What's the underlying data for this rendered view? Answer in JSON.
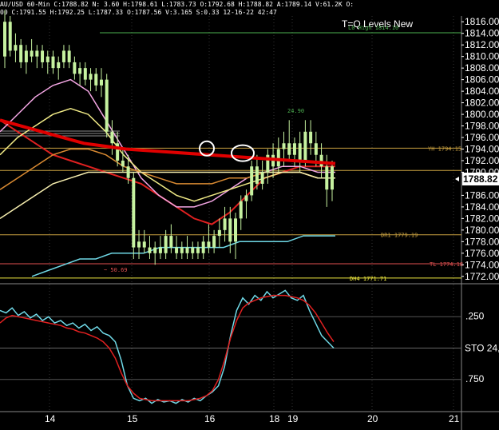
{
  "header": "AU/USD 60-Min C:1788.82 N: 3.60 H:1798.61 L:1783.73 O:1792.68 H:1788.82 A:1789.14 V:61.2K O:",
  "subheader": "00 C:1791.55 H:1792.25 L:1787.33 O:1787.56 V:3.165 S:0.33 12-16-22 42:47",
  "title": "T=Q Levels New",
  "colors": {
    "background": "#000000",
    "candle": "#c6f2a0",
    "ma_red": "#e02020",
    "ma_pink": "#f4a6e4",
    "ma_yellow": "#f0ea86",
    "ma_orange": "#d98a32",
    "ma_cyan": "#6fd8e6",
    "trendline": "#e00000",
    "sto_fast": "#6fd8e6",
    "sto_slow": "#e02020"
  },
  "chart_data": [
    {
      "type": "line",
      "panel": "price",
      "y_ticks": [
        "1816.00",
        "1814.00",
        "1812.00",
        "1810.00",
        "1808.00",
        "1806.00",
        "1804.00",
        "1802.00",
        "1800.00",
        "1798.00",
        "1796.00",
        "1794.00",
        "1792.00",
        "1790.00",
        "1788.82",
        "1786.00",
        "1784.00",
        "1782.00",
        "1780.00",
        "1778.00",
        "1776.00",
        "1774.00",
        "1772.00"
      ],
      "ylim": [
        1771,
        1817
      ],
      "x_ticks": [
        "14",
        "15",
        "16",
        "18",
        "19",
        "20",
        "21"
      ],
      "last_price": "1788.82",
      "levels": [
        {
          "label": "L0 High 1814.10",
          "value": 1814.1,
          "color": "#4caf50"
        },
        {
          "label": "YH 1794.15",
          "value": 1794.15,
          "color": "#c8a040"
        },
        {
          "label": "DR1 1779.19",
          "value": 1779.19,
          "color": "#c8a040"
        },
        {
          "label": "TL 1774.18",
          "value": 1774.18,
          "color": "#e05050"
        },
        {
          "label": "DH4 1771.71",
          "value": 1771.71,
          "color": "#f0ea40"
        }
      ],
      "annotations": [
        "24.90",
        "~ 50.69"
      ],
      "candles": [
        {
          "o": 1810,
          "h": 1818,
          "l": 1808,
          "c": 1816
        },
        {
          "o": 1816,
          "h": 1817,
          "l": 1810,
          "c": 1811
        },
        {
          "o": 1811,
          "h": 1814,
          "l": 1809,
          "c": 1812
        },
        {
          "o": 1812,
          "h": 1813,
          "l": 1808,
          "c": 1809
        },
        {
          "o": 1809,
          "h": 1812,
          "l": 1807,
          "c": 1811
        },
        {
          "o": 1811,
          "h": 1813,
          "l": 1809,
          "c": 1810
        },
        {
          "o": 1810,
          "h": 1812,
          "l": 1808,
          "c": 1811
        },
        {
          "o": 1811,
          "h": 1812,
          "l": 1808,
          "c": 1809
        },
        {
          "o": 1809,
          "h": 1811,
          "l": 1807,
          "c": 1810
        },
        {
          "o": 1810,
          "h": 1811,
          "l": 1807,
          "c": 1808
        },
        {
          "o": 1808,
          "h": 1810,
          "l": 1806,
          "c": 1809
        },
        {
          "o": 1809,
          "h": 1812,
          "l": 1808,
          "c": 1811
        },
        {
          "o": 1811,
          "h": 1812,
          "l": 1808,
          "c": 1809
        },
        {
          "o": 1809,
          "h": 1810,
          "l": 1806,
          "c": 1807
        },
        {
          "o": 1807,
          "h": 1809,
          "l": 1805,
          "c": 1808
        },
        {
          "o": 1808,
          "h": 1809,
          "l": 1805,
          "c": 1806
        },
        {
          "o": 1806,
          "h": 1808,
          "l": 1804,
          "c": 1807
        },
        {
          "o": 1807,
          "h": 1808,
          "l": 1804,
          "c": 1805
        },
        {
          "o": 1805,
          "h": 1808,
          "l": 1803,
          "c": 1806
        },
        {
          "o": 1806,
          "h": 1807,
          "l": 1796,
          "c": 1797
        },
        {
          "o": 1797,
          "h": 1799,
          "l": 1793,
          "c": 1795
        },
        {
          "o": 1795,
          "h": 1797,
          "l": 1791,
          "c": 1792
        },
        {
          "o": 1792,
          "h": 1794,
          "l": 1790,
          "c": 1791
        },
        {
          "o": 1791,
          "h": 1793,
          "l": 1788,
          "c": 1789
        },
        {
          "o": 1789,
          "h": 1790,
          "l": 1775,
          "c": 1777
        },
        {
          "o": 1777,
          "h": 1780,
          "l": 1775,
          "c": 1778
        },
        {
          "o": 1778,
          "h": 1780,
          "l": 1776,
          "c": 1777
        },
        {
          "o": 1777,
          "h": 1779,
          "l": 1775,
          "c": 1776
        },
        {
          "o": 1776,
          "h": 1778,
          "l": 1774,
          "c": 1777
        },
        {
          "o": 1777,
          "h": 1779,
          "l": 1775,
          "c": 1776
        },
        {
          "o": 1776,
          "h": 1780,
          "l": 1775,
          "c": 1779
        },
        {
          "o": 1779,
          "h": 1781,
          "l": 1776,
          "c": 1777
        },
        {
          "o": 1777,
          "h": 1779,
          "l": 1775,
          "c": 1776
        },
        {
          "o": 1776,
          "h": 1778,
          "l": 1775,
          "c": 1777
        },
        {
          "o": 1777,
          "h": 1779,
          "l": 1775,
          "c": 1776
        },
        {
          "o": 1776,
          "h": 1778,
          "l": 1775,
          "c": 1777
        },
        {
          "o": 1777,
          "h": 1778,
          "l": 1775,
          "c": 1776
        },
        {
          "o": 1776,
          "h": 1779,
          "l": 1775,
          "c": 1778
        },
        {
          "o": 1778,
          "h": 1781,
          "l": 1776,
          "c": 1777
        },
        {
          "o": 1777,
          "h": 1780,
          "l": 1776,
          "c": 1779
        },
        {
          "o": 1779,
          "h": 1782,
          "l": 1777,
          "c": 1780
        },
        {
          "o": 1780,
          "h": 1784,
          "l": 1778,
          "c": 1782
        },
        {
          "o": 1782,
          "h": 1784,
          "l": 1776,
          "c": 1778
        },
        {
          "o": 1778,
          "h": 1783,
          "l": 1775,
          "c": 1782
        },
        {
          "o": 1782,
          "h": 1786,
          "l": 1780,
          "c": 1785
        },
        {
          "o": 1785,
          "h": 1787,
          "l": 1782,
          "c": 1786
        },
        {
          "o": 1786,
          "h": 1792,
          "l": 1785,
          "c": 1791
        },
        {
          "o": 1791,
          "h": 1793,
          "l": 1787,
          "c": 1788
        },
        {
          "o": 1788,
          "h": 1792,
          "l": 1787,
          "c": 1790
        },
        {
          "o": 1790,
          "h": 1794,
          "l": 1788,
          "c": 1793
        },
        {
          "o": 1793,
          "h": 1795,
          "l": 1789,
          "c": 1791
        },
        {
          "o": 1791,
          "h": 1796,
          "l": 1790,
          "c": 1794
        },
        {
          "o": 1794,
          "h": 1797,
          "l": 1791,
          "c": 1795
        },
        {
          "o": 1795,
          "h": 1799,
          "l": 1792,
          "c": 1793
        },
        {
          "o": 1793,
          "h": 1796,
          "l": 1791,
          "c": 1795
        },
        {
          "o": 1795,
          "h": 1797,
          "l": 1790,
          "c": 1792
        },
        {
          "o": 1792,
          "h": 1799,
          "l": 1791,
          "c": 1797
        },
        {
          "o": 1797,
          "h": 1799,
          "l": 1793,
          "c": 1795
        },
        {
          "o": 1795,
          "h": 1797,
          "l": 1791,
          "c": 1793
        },
        {
          "o": 1793,
          "h": 1795,
          "l": 1789,
          "c": 1791
        },
        {
          "o": 1791,
          "h": 1793,
          "l": 1784,
          "c": 1787
        },
        {
          "o": 1787,
          "h": 1792,
          "l": 1785,
          "c": 1791
        }
      ],
      "series": [
        {
          "values": [
            1799,
            1797,
            1795,
            1793,
            1792,
            1791,
            1790,
            1789,
            1788,
            1786,
            1784,
            1782,
            1781,
            1783,
            1786,
            1789,
            1790,
            1791,
            1791,
            1791
          ]
        },
        {
          "values": [
            1797,
            1800,
            1803,
            1805,
            1806,
            1804,
            1799,
            1794,
            1789,
            1786,
            1784,
            1784,
            1785,
            1787,
            1789,
            1790,
            1791,
            1791,
            1790,
            1790
          ]
        },
        {
          "values": [
            1793,
            1796,
            1798,
            1800,
            1801,
            1800,
            1797,
            1793,
            1790,
            1788,
            1786,
            1785,
            1786,
            1787,
            1788,
            1789,
            1790,
            1790,
            1789,
            1789
          ]
        },
        {
          "values": [
            1787,
            1789,
            1791,
            1793,
            1794,
            1794,
            1793,
            1791,
            1790,
            1789,
            1788,
            1788,
            1788,
            1789,
            1789,
            1790,
            1790,
            1790,
            1789,
            1789
          ]
        },
        {
          "values": [
            1782,
            1784,
            1786,
            1788,
            1789,
            1790,
            1790,
            1790,
            1790,
            1790,
            1790,
            1790,
            1790,
            1790,
            1790,
            1790,
            1790,
            1790,
            1789,
            1789
          ]
        },
        {
          "values": [
            1772,
            1773,
            1774,
            1775,
            1775,
            1776,
            1776,
            1776,
            1777,
            1777,
            1777,
            1777,
            1777,
            1778,
            1778,
            1778,
            1778,
            1779,
            1779,
            1779
          ]
        },
        {
          "values": [
            1799,
            1797,
            1795,
            1794,
            1793.5,
            1793,
            1792.5,
            1792,
            1791.5
          ]
        }
      ]
    },
    {
      "type": "line",
      "panel": "stochastic",
      "label": "STO 24,",
      "y_ticks": [
        ".250",
        ".750"
      ],
      "ylim": [
        0,
        100
      ],
      "series": [
        {
          "values": [
            80,
            78,
            82,
            76,
            79,
            74,
            77,
            72,
            75,
            70,
            72,
            68,
            70,
            66,
            69,
            64,
            67,
            62,
            60,
            55,
            40,
            20,
            10,
            8,
            10,
            6,
            9,
            7,
            8,
            6,
            9,
            7,
            10,
            8,
            12,
            15,
            20,
            35,
            60,
            80,
            90,
            85,
            92,
            88,
            95,
            90,
            93,
            96,
            90,
            88,
            92,
            80,
            70,
            60,
            55,
            50
          ]
        },
        {
          "values": [
            70,
            74,
            76,
            75,
            74,
            73,
            72,
            71,
            70,
            69,
            68,
            66,
            65,
            63,
            62,
            60,
            58,
            55,
            50,
            42,
            30,
            20,
            14,
            10,
            9,
            8,
            8,
            8,
            8,
            8,
            8,
            8,
            9,
            10,
            12,
            16,
            25,
            40,
            58,
            72,
            82,
            86,
            88,
            90,
            91,
            92,
            92,
            92,
            91,
            90,
            88,
            84,
            78,
            70,
            62,
            55
          ]
        }
      ]
    }
  ]
}
